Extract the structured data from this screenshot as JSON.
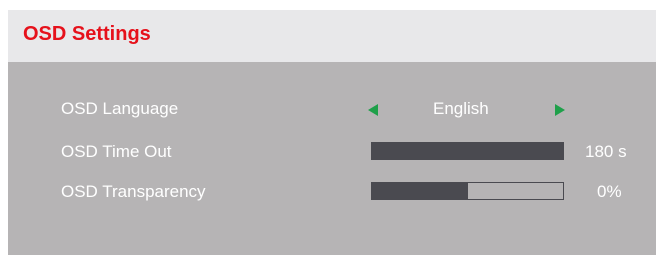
{
  "osd": {
    "title": "OSD Settings",
    "items": [
      {
        "label": "OSD Language",
        "value": "English"
      },
      {
        "label": "OSD Time Out",
        "value": "180 s",
        "level_pct": 100
      },
      {
        "label": "OSD Transparency",
        "value": "0%",
        "level_pct": 50
      }
    ]
  },
  "icons": {
    "prev": "triangle-left-icon",
    "next": "triangle-right-icon"
  },
  "colors": {
    "title": "#e6111b",
    "header_bg": "#e8e8ea",
    "panel_bg": "#b6b4b5",
    "bar_fill": "#4a4a50",
    "arrow": "#1fa04a",
    "text": "#ffffff"
  }
}
